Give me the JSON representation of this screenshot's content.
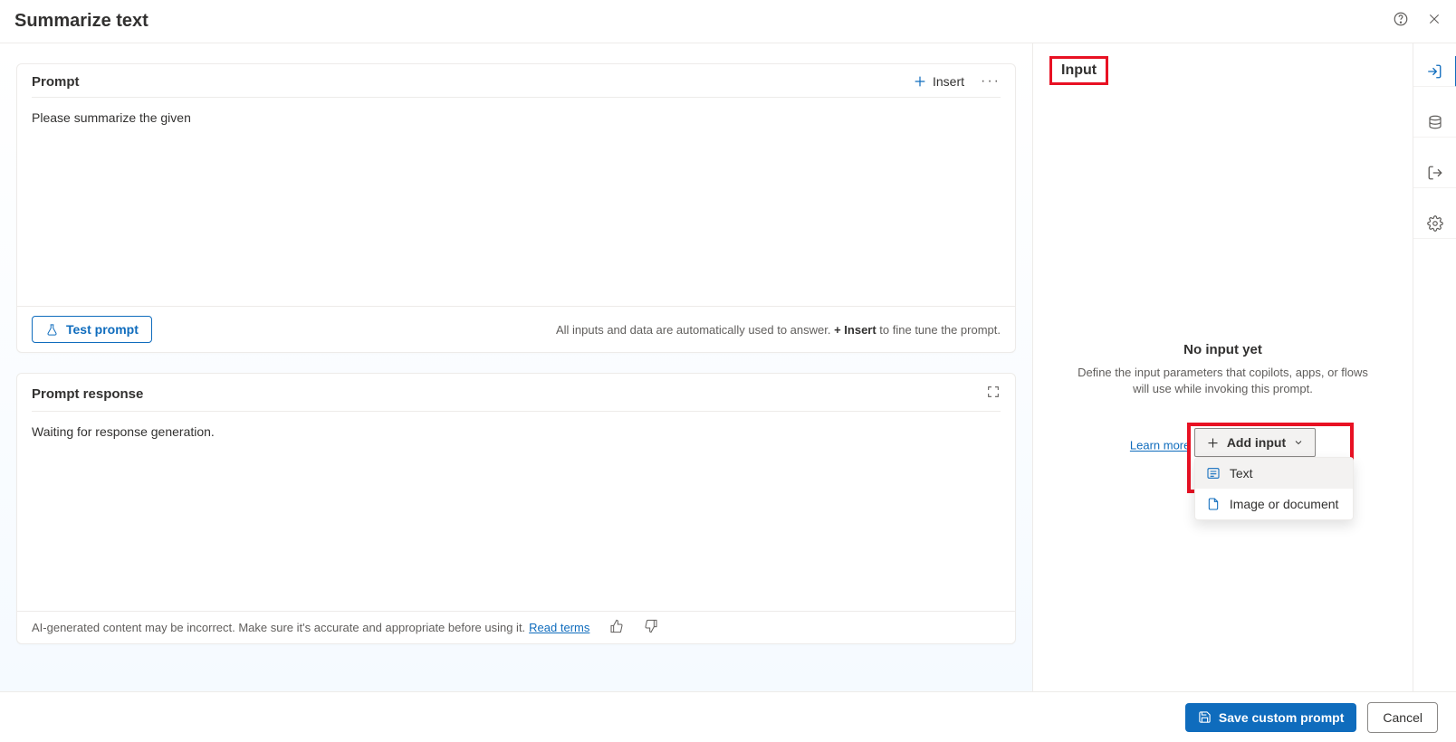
{
  "header": {
    "title": "Summarize text"
  },
  "prompt": {
    "section_title": "Prompt",
    "insert_label": "Insert",
    "body_text": "Please summarize the given",
    "test_label": "Test prompt",
    "hint_prefix": "All inputs and data are automatically used to answer. ",
    "hint_bold": "+ Insert",
    "hint_suffix": " to fine tune the prompt."
  },
  "response": {
    "section_title": "Prompt response",
    "body_text": "Waiting for response generation.",
    "disclaimer": "AI-generated content may be incorrect. Make sure it's accurate and appropriate before using it. ",
    "read_terms": "Read terms"
  },
  "right": {
    "tab_label": "Input",
    "empty_title": "No input yet",
    "empty_desc": "Define the input parameters that copilots, apps, or flows will use while invoking this prompt.",
    "learn_more": "Learn more",
    "add_input_label": "Add input",
    "options": {
      "text": "Text",
      "image": "Image or document"
    }
  },
  "footer": {
    "save_label": "Save custom prompt",
    "cancel_label": "Cancel"
  }
}
